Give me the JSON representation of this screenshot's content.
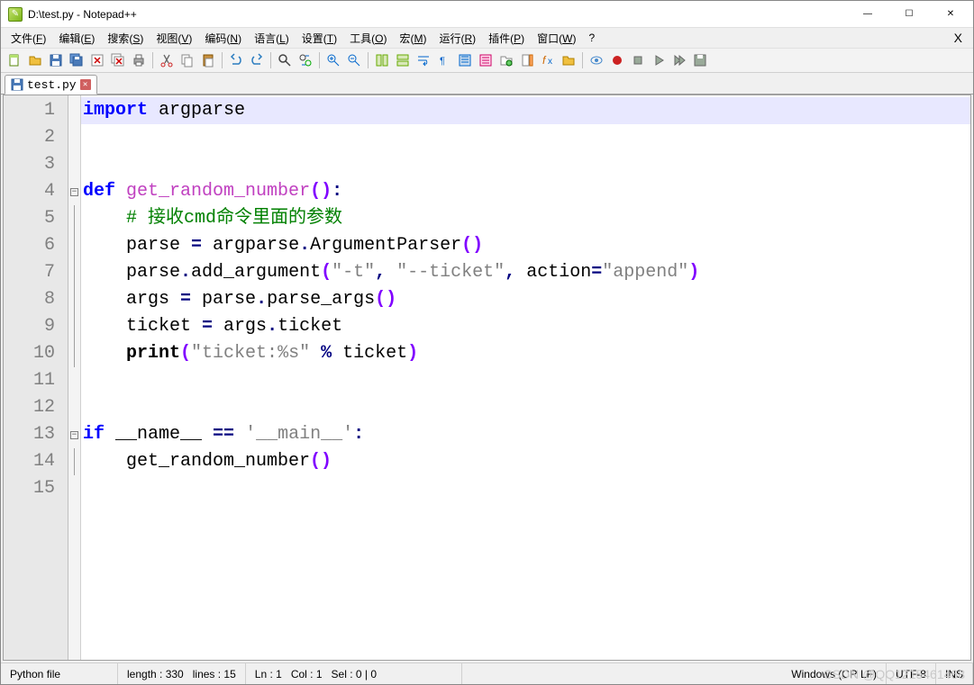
{
  "window": {
    "title": "D:\\test.py - Notepad++",
    "min_glyph": "—",
    "max_glyph": "☐",
    "close_glyph": "✕"
  },
  "menu": {
    "items": [
      {
        "label": "文件",
        "accel": "F"
      },
      {
        "label": "编辑",
        "accel": "E"
      },
      {
        "label": "搜索",
        "accel": "S"
      },
      {
        "label": "视图",
        "accel": "V"
      },
      {
        "label": "编码",
        "accel": "N"
      },
      {
        "label": "语言",
        "accel": "L"
      },
      {
        "label": "设置",
        "accel": "T"
      },
      {
        "label": "工具",
        "accel": "O"
      },
      {
        "label": "宏",
        "accel": "M"
      },
      {
        "label": "运行",
        "accel": "R"
      },
      {
        "label": "插件",
        "accel": "P"
      },
      {
        "label": "窗口",
        "accel": "W"
      },
      {
        "label": "?",
        "accel": ""
      }
    ],
    "close_x": "X"
  },
  "tab": {
    "filename": "test.py"
  },
  "code": {
    "line_count": 15,
    "lines": [
      {
        "n": 1,
        "tokens": [
          [
            "kw",
            "import"
          ],
          [
            "",
            " argparse"
          ]
        ]
      },
      {
        "n": 2,
        "tokens": []
      },
      {
        "n": 3,
        "tokens": []
      },
      {
        "n": 4,
        "fold": "start",
        "tokens": [
          [
            "kw",
            "def"
          ],
          [
            "",
            " "
          ],
          [
            "def-name",
            "get_random_number"
          ],
          [
            "paren",
            "()"
          ],
          [
            "op",
            ":"
          ]
        ]
      },
      {
        "n": 5,
        "tokens": [
          [
            "",
            "    "
          ],
          [
            "cmt",
            "# 接收cmd命令里面的参数"
          ]
        ]
      },
      {
        "n": 6,
        "tokens": [
          [
            "",
            "    parse "
          ],
          [
            "op",
            "="
          ],
          [
            "",
            " argparse"
          ],
          [
            "op",
            "."
          ],
          [
            "",
            "ArgumentParser"
          ],
          [
            "paren",
            "()"
          ]
        ]
      },
      {
        "n": 7,
        "tokens": [
          [
            "",
            "    parse"
          ],
          [
            "op",
            "."
          ],
          [
            "",
            "add_argument"
          ],
          [
            "paren",
            "("
          ],
          [
            "str",
            "\"-t\""
          ],
          [
            "op",
            ","
          ],
          [
            "",
            " "
          ],
          [
            "str",
            "\"--ticket\""
          ],
          [
            "op",
            ","
          ],
          [
            "",
            " action"
          ],
          [
            "op",
            "="
          ],
          [
            "str",
            "\"append\""
          ],
          [
            "paren",
            ")"
          ]
        ]
      },
      {
        "n": 8,
        "tokens": [
          [
            "",
            "    args "
          ],
          [
            "op",
            "="
          ],
          [
            "",
            " parse"
          ],
          [
            "op",
            "."
          ],
          [
            "",
            "parse_args"
          ],
          [
            "paren",
            "()"
          ]
        ]
      },
      {
        "n": 9,
        "tokens": [
          [
            "",
            "    ticket "
          ],
          [
            "op",
            "="
          ],
          [
            "",
            " args"
          ],
          [
            "op",
            "."
          ],
          [
            "",
            "ticket"
          ]
        ]
      },
      {
        "n": 10,
        "tokens": [
          [
            "",
            "    "
          ],
          [
            "builtin",
            "print"
          ],
          [
            "paren",
            "("
          ],
          [
            "str",
            "\"ticket:%s\""
          ],
          [
            "",
            " "
          ],
          [
            "op",
            "%"
          ],
          [
            "",
            " ticket"
          ],
          [
            "paren",
            ")"
          ]
        ]
      },
      {
        "n": 11,
        "tokens": []
      },
      {
        "n": 12,
        "tokens": []
      },
      {
        "n": 13,
        "fold": "start",
        "tokens": [
          [
            "kw",
            "if"
          ],
          [
            "",
            " __name__ "
          ],
          [
            "op",
            "=="
          ],
          [
            "",
            " "
          ],
          [
            "str",
            "'__main__'"
          ],
          [
            "op",
            ":"
          ]
        ]
      },
      {
        "n": 14,
        "tokens": [
          [
            "",
            "    get_random_number"
          ],
          [
            "paren",
            "()"
          ]
        ]
      },
      {
        "n": 15,
        "tokens": []
      }
    ]
  },
  "status": {
    "type": "Python file",
    "length": "length : 330",
    "lines": "lines : 15",
    "ln": "Ln : 1",
    "col": "Col : 1",
    "sel": "Sel : 0 | 0",
    "eol": "Windows (CR LF)",
    "encoding": "UTF-8",
    "mode": "INS"
  },
  "watermark": "CSDN @QQ1215461468"
}
